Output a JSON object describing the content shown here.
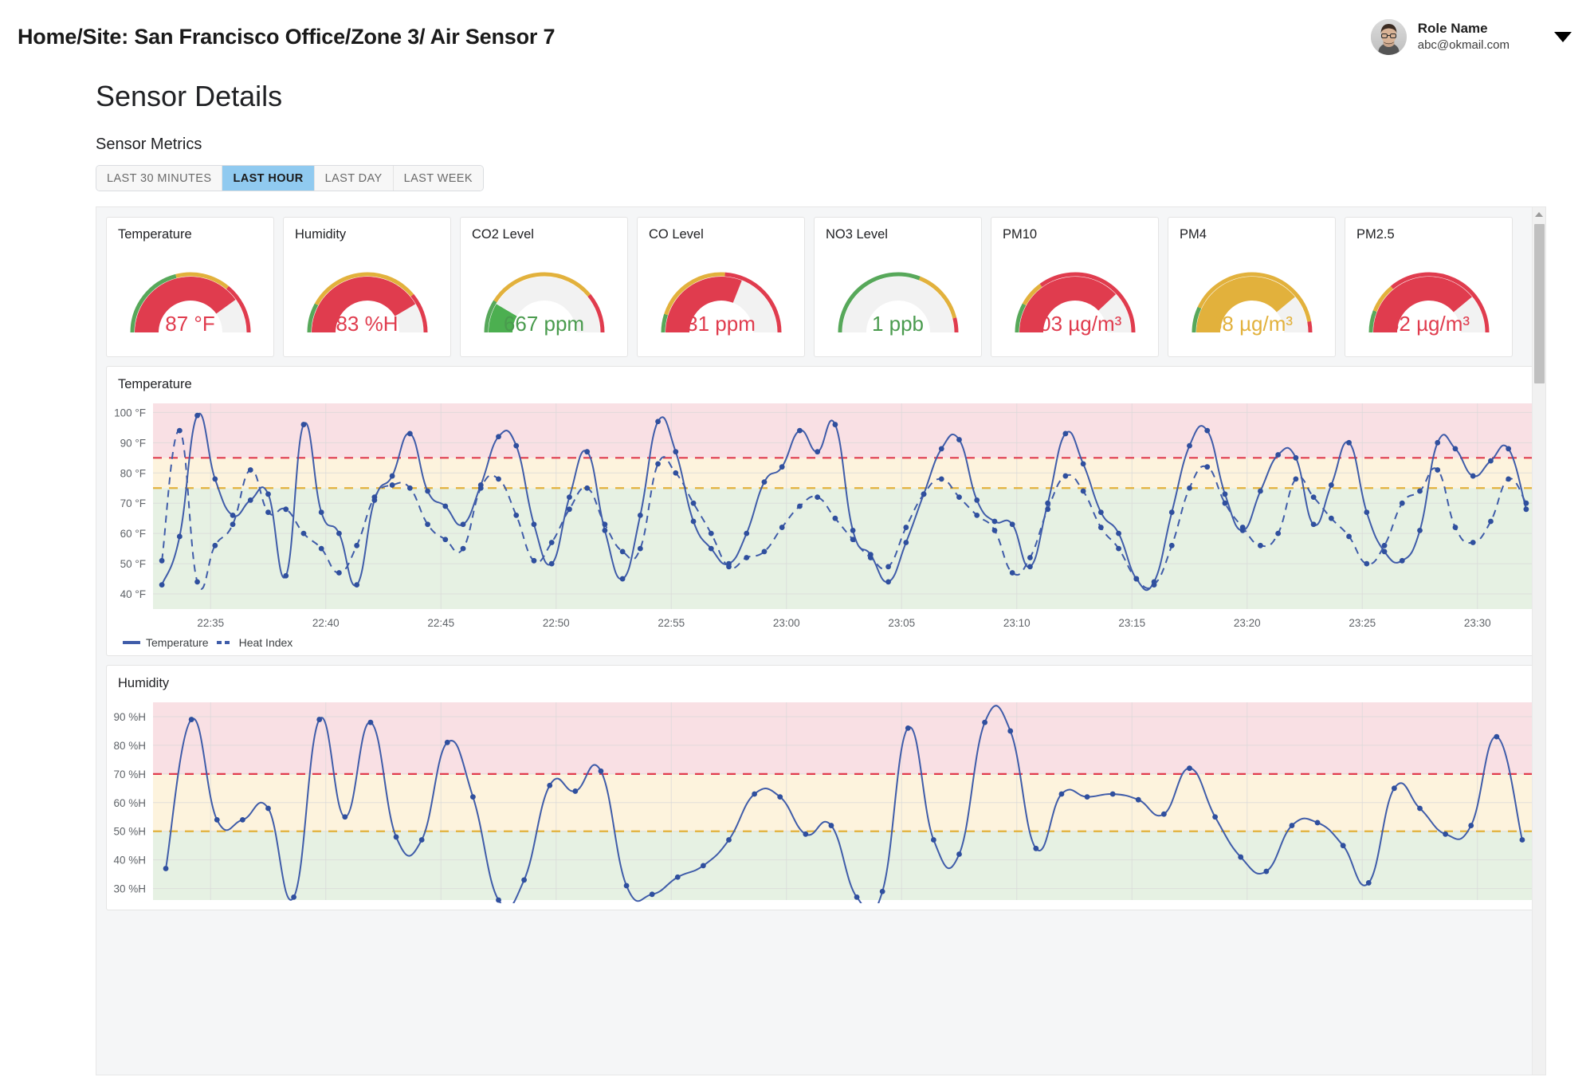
{
  "header": {
    "breadcrumb": "Home/Site: San Francisco Office/Zone 3/ Air Sensor 7",
    "user": {
      "name": "Role Name",
      "email": "abc@okmail.com"
    }
  },
  "page": {
    "title": "Sensor Details",
    "section_label": "Sensor Metrics"
  },
  "tabs": [
    {
      "label": "LAST 30 MINUTES",
      "active": false
    },
    {
      "label": "LAST HOUR",
      "active": true
    },
    {
      "label": "LAST DAY",
      "active": false
    },
    {
      "label": "LAST WEEK",
      "active": false
    }
  ],
  "colors": {
    "green": "#4caf50",
    "green_stroke": "#57a85a",
    "yellow": "#e2b13c",
    "red": "#e03c4e",
    "grey": "#f2f2f2",
    "line_blue": "#3f5ca9",
    "accent_tab": "#90caf0"
  },
  "gauges": [
    {
      "title": "Temperature",
      "value": "87 °F",
      "value_color": "#e03c4e",
      "pct": 0.8,
      "arc_color": "#e03c4e",
      "zones": [
        0.42,
        0.3,
        0.28
      ]
    },
    {
      "title": "Humidity",
      "value": "83 %H",
      "value_color": "#e03c4e",
      "pct": 0.83,
      "arc_color": "#e03c4e",
      "zones": [
        0.16,
        0.62,
        0.22
      ]
    },
    {
      "title": "CO2 Level",
      "value": "667 ppm",
      "value_color": "#4a9b4e",
      "pct": 0.17,
      "arc_color": "#4caf50",
      "zones": [
        0.18,
        0.6,
        0.22
      ]
    },
    {
      "title": "CO Level",
      "value": "31 ppm",
      "value_color": "#e03c4e",
      "pct": 0.62,
      "arc_color": "#e03c4e",
      "zones": [
        0.1,
        0.42,
        0.48
      ]
    },
    {
      "title": "NO3 Level",
      "value": "1 ppb",
      "value_color": "#4a9b4e",
      "pct": 0.01,
      "arc_color": "#4caf50",
      "zones": [
        0.62,
        0.3,
        0.08
      ]
    },
    {
      "title": "PM10",
      "value": "103 µg/m³",
      "value_color": "#e03c4e",
      "pct": 0.76,
      "arc_color": "#e03c4e",
      "zones": [
        0.16,
        0.14,
        0.7
      ]
    },
    {
      "title": "PM4",
      "value": "68 µg/m³",
      "value_color": "#e2b13c",
      "pct": 0.78,
      "arc_color": "#e2b13c",
      "zones": [
        0.14,
        0.8,
        0.06
      ]
    },
    {
      "title": "PM2.5",
      "value": "82 µg/m³",
      "value_color": "#e03c4e",
      "pct": 0.78,
      "arc_color": "#e03c4e",
      "zones": [
        0.12,
        0.16,
        0.72
      ]
    }
  ],
  "chart_data": [
    {
      "type": "line",
      "title": "Temperature",
      "xlabel": "",
      "ylabel": "",
      "ylim": [
        35,
        103
      ],
      "yticks": [
        40,
        50,
        60,
        70,
        80,
        90,
        100
      ],
      "ytick_labels": [
        "40 °F",
        "50 °F",
        "60 °F",
        "70 °F",
        "80 °F",
        "90 °F",
        "100 °F"
      ],
      "xticks": [
        "22:35",
        "22:40",
        "22:45",
        "22:50",
        "22:55",
        "23:00",
        "23:05",
        "23:10",
        "23:15",
        "23:20",
        "23:25",
        "23:30"
      ],
      "grid": true,
      "legend_position": "bottom-left",
      "bands": [
        {
          "from": 35,
          "to": 75,
          "color": "#e6f1e3"
        },
        {
          "from": 75,
          "to": 85,
          "color": "#fdf3dd"
        },
        {
          "from": 85,
          "to": 103,
          "color": "#f9e0e4"
        }
      ],
      "thresholds": [
        {
          "value": 75,
          "color": "#e2b13c",
          "style": "dashed"
        },
        {
          "value": 85,
          "color": "#e03c4e",
          "style": "dashed"
        }
      ],
      "series": [
        {
          "name": "Temperature",
          "style": "solid",
          "color": "#3f5ca9",
          "values": [
            43,
            59,
            99,
            78,
            66,
            71,
            73,
            46,
            96,
            67,
            60,
            43,
            71,
            79,
            93,
            74,
            69,
            63,
            76,
            92,
            89,
            63,
            50,
            72,
            87,
            61,
            45,
            66,
            97,
            87,
            64,
            55,
            50,
            60,
            77,
            82,
            94,
            87,
            96,
            61,
            53,
            44,
            57,
            73,
            88,
            91,
            71,
            64,
            63,
            49,
            70,
            93,
            83,
            67,
            60,
            45,
            44,
            67,
            89,
            94,
            73,
            61,
            74,
            86,
            85,
            63,
            76,
            90,
            67,
            54,
            51,
            61,
            90,
            88,
            79,
            84,
            88,
            68
          ]
        },
        {
          "name": "Heat Index",
          "style": "dashed",
          "color": "#3f5ca9",
          "values": [
            51,
            94,
            44,
            56,
            63,
            81,
            67,
            68,
            60,
            55,
            47,
            56,
            72,
            76,
            75,
            63,
            58,
            55,
            75,
            78,
            66,
            51,
            57,
            68,
            75,
            63,
            54,
            55,
            83,
            80,
            70,
            60,
            49,
            52,
            54,
            62,
            69,
            72,
            65,
            58,
            52,
            49,
            62,
            73,
            78,
            72,
            66,
            61,
            47,
            52,
            68,
            79,
            74,
            62,
            55,
            45,
            43,
            56,
            75,
            82,
            70,
            62,
            56,
            60,
            78,
            72,
            65,
            59,
            50,
            56,
            70,
            74,
            81,
            62,
            57,
            64,
            78,
            70
          ]
        }
      ]
    },
    {
      "type": "line",
      "title": "Humidity",
      "xlabel": "",
      "ylabel": "",
      "ylim": [
        26,
        95
      ],
      "yticks": [
        30,
        40,
        50,
        60,
        70,
        80,
        90
      ],
      "ytick_labels": [
        "30 %H",
        "40 %H",
        "50 %H",
        "60 %H",
        "70 %H",
        "80 %H",
        "90 %H"
      ],
      "xticks": [],
      "grid": true,
      "legend_position": "none",
      "bands": [
        {
          "from": 26,
          "to": 50,
          "color": "#e6f1e3"
        },
        {
          "from": 50,
          "to": 70,
          "color": "#fdf3dd"
        },
        {
          "from": 70,
          "to": 95,
          "color": "#f9e0e4"
        }
      ],
      "thresholds": [
        {
          "value": 50,
          "color": "#e2b13c",
          "style": "dashed"
        },
        {
          "value": 70,
          "color": "#e03c4e",
          "style": "dashed"
        }
      ],
      "series": [
        {
          "name": "Humidity",
          "style": "solid",
          "color": "#3f5ca9",
          "values": [
            37,
            89,
            54,
            54,
            58,
            27,
            89,
            55,
            88,
            48,
            47,
            81,
            62,
            26,
            33,
            66,
            64,
            71,
            31,
            28,
            34,
            38,
            47,
            63,
            62,
            49,
            52,
            27,
            29,
            86,
            47,
            42,
            88,
            85,
            44,
            63,
            62,
            63,
            61,
            56,
            72,
            55,
            41,
            36,
            52,
            53,
            45,
            32,
            65,
            58,
            49,
            52,
            83,
            47
          ]
        }
      ]
    }
  ],
  "scrollbar": {
    "up_arrow": "scroll-up"
  }
}
